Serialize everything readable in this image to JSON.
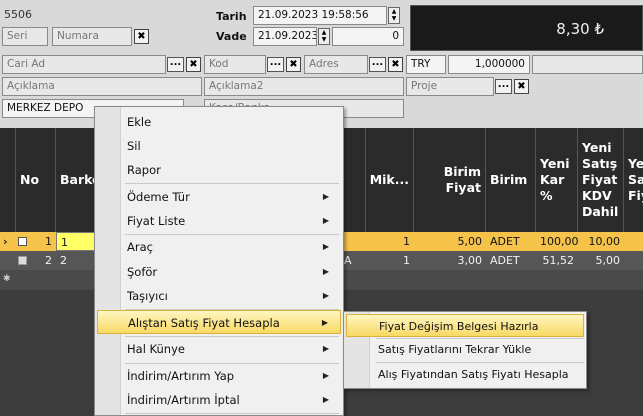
{
  "form": {
    "doc_no": "5506",
    "seri_placeholder": "Seri",
    "numara_placeholder": "Numara",
    "tarih_label": "Tarih",
    "tarih_value": "21.09.2023 19:58:56",
    "vade_label": "Vade",
    "vade_value": "21.09.2023",
    "vade_days": "0",
    "total": "8,30 ₺",
    "cari_ad_placeholder": "Cari Ad",
    "kod_placeholder": "Kod",
    "adres_placeholder": "Adres",
    "currency": "TRY",
    "rate": "1,000000",
    "aciklama_placeholder": "Açıklama",
    "aciklama2_placeholder": "Açıklama2",
    "proje_placeholder": "Proje",
    "depo_value": "MERKEZ DEPO",
    "kasa_placeholder": "Kasa/Banka",
    "dots": "...",
    "x": "✖"
  },
  "grid": {
    "headers": {
      "no": "No",
      "barkod": "Barko",
      "miktar": "Mik...",
      "birim_fiyat": "Birim Fiyat",
      "birim": "Birim",
      "yeni_kar": "Yeni Kar %",
      "yeni_satis": "Yeni Satış Fiyat KDV Dahil",
      "extra": "Ye Sa Fiy"
    },
    "rows": [
      {
        "no": "1",
        "barkod": "1",
        "name_tail": "",
        "miktar": "1",
        "birim_fiyat": "5,00",
        "birim": "ADET",
        "kar": "100,00",
        "satis": "10,00"
      },
      {
        "no": "2",
        "barkod": "2",
        "name_tail": "A",
        "miktar": "1",
        "birim_fiyat": "3,00",
        "birim": "ADET",
        "kar": "51,52",
        "satis": "5,00"
      }
    ],
    "new_row_marker": "✱",
    "current_marker": "›"
  },
  "menu": {
    "items": [
      {
        "label": "Ekle"
      },
      {
        "label": "Sil"
      },
      {
        "label": "Rapor"
      },
      {
        "label": "Ödeme Tür"
      },
      {
        "label": "Fiyat Liste"
      },
      {
        "label": "Araç"
      },
      {
        "label": "Şoför"
      },
      {
        "label": "Taşıyıcı"
      },
      {
        "label": "Alıştan Satış Fiyat Hesapla"
      },
      {
        "label": "Hal Künye"
      },
      {
        "label": "İndirim/Artırım Yap"
      },
      {
        "label": "İndirim/Artırım İptal"
      }
    ],
    "arrow": "▶"
  },
  "submenu": {
    "items": [
      {
        "label": "Fiyat Değişim Belgesi Hazırla"
      },
      {
        "label": "Satış Fiyatlarını Tekrar Yükle"
      },
      {
        "label": "Alış Fiyatından Satış Fiyatı Hesapla"
      }
    ]
  }
}
